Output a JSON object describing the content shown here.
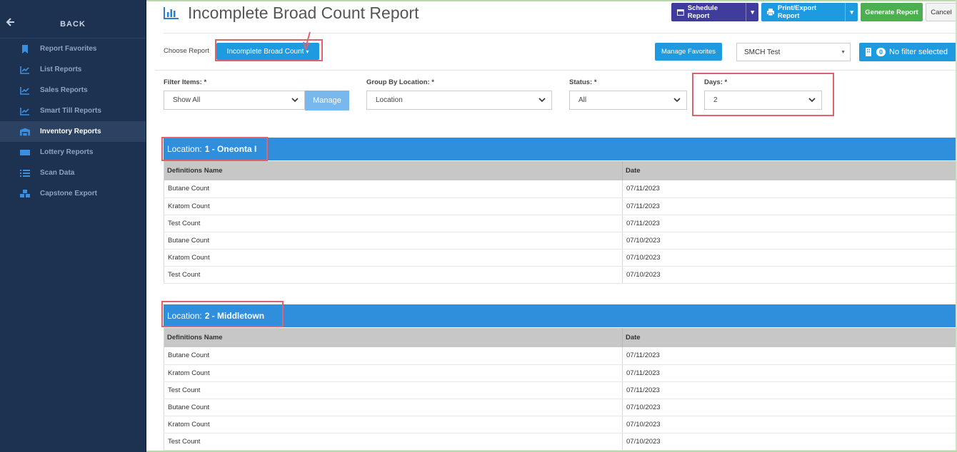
{
  "sidebar": {
    "back_label": "BACK",
    "items": [
      {
        "label": "Report Favorites",
        "icon": "bookmark-icon"
      },
      {
        "label": "List Reports",
        "icon": "line-chart-icon"
      },
      {
        "label": "Sales Reports",
        "icon": "line-chart-icon"
      },
      {
        "label": "Smart Till Reports",
        "icon": "line-chart-icon"
      },
      {
        "label": "Inventory Reports",
        "icon": "warehouse-icon",
        "active": true
      },
      {
        "label": "Lottery Reports",
        "icon": "ticket-icon"
      },
      {
        "label": "Scan Data",
        "icon": "list-icon"
      },
      {
        "label": "Capstone Export",
        "icon": "cubes-icon"
      }
    ]
  },
  "header": {
    "title": "Incomplete Broad Count Report",
    "schedule_label": "Schedule Report",
    "print_label": "Print/Export Report",
    "generate_label": "Generate Report",
    "cancel_label": "Cancel"
  },
  "choose": {
    "label": "Choose Report",
    "selected": "Incomplete Broad Count",
    "manage_favorites": "Manage Favorites",
    "store": "SMCH Test",
    "filter_count": "0",
    "filter_text": "No filter selected"
  },
  "filters": {
    "items_label": "Filter Items: *",
    "items_value": "Show All",
    "manage_label": "Manage",
    "group_label": "Group By Location: *",
    "group_value": "Location",
    "status_label": "Status: *",
    "status_value": "All",
    "days_label": "Days: *",
    "days_value": "2"
  },
  "columns": [
    "Definitions Name",
    "Date"
  ],
  "locations": [
    {
      "prefix": "Location:",
      "name": "1 - Oneonta I",
      "rows": [
        [
          "Butane Count",
          "07/11/2023"
        ],
        [
          "Kratom Count",
          "07/11/2023"
        ],
        [
          "Test Count",
          "07/11/2023"
        ],
        [
          "Butane Count",
          "07/10/2023"
        ],
        [
          "Kratom Count",
          "07/10/2023"
        ],
        [
          "Test Count",
          "07/10/2023"
        ]
      ]
    },
    {
      "prefix": "Location:",
      "name": "2 - Middletown",
      "rows": [
        [
          "Butane Count",
          "07/11/2023"
        ],
        [
          "Kratom Count",
          "07/11/2023"
        ],
        [
          "Test Count",
          "07/11/2023"
        ],
        [
          "Butane Count",
          "07/10/2023"
        ],
        [
          "Kratom Count",
          "07/10/2023"
        ],
        [
          "Test Count",
          "07/10/2023"
        ]
      ]
    }
  ],
  "colors": {
    "sidebar_bg": "#1d3150",
    "accent_blue": "#1e9be0",
    "location_bar": "#2f8fdc",
    "highlight": "#e0626a"
  }
}
